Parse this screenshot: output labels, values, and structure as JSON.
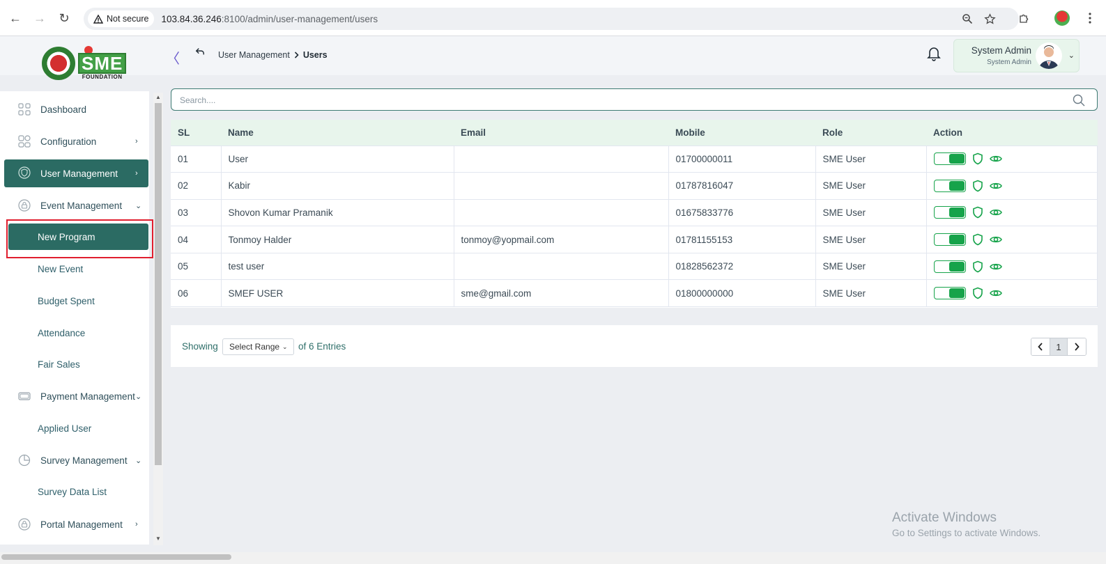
{
  "browser": {
    "security_label": "Not secure",
    "url_host": "103.84.36.246",
    "url_rest": ":8100/admin/user-management/users"
  },
  "header": {
    "logo_text": "SME",
    "logo_subtext": "FOUNDATION",
    "breadcrumb_parent": "User Management",
    "breadcrumb_current": "Users",
    "user_name": "System Admin",
    "user_role": "System Admin"
  },
  "sidebar": {
    "items": [
      {
        "label": "Dashboard"
      },
      {
        "label": "Configuration"
      },
      {
        "label": "User Management"
      },
      {
        "label": "Event Management"
      },
      {
        "label": "Payment Management"
      },
      {
        "label": "Survey Management"
      },
      {
        "label": "Portal Management"
      }
    ],
    "sub_items": [
      {
        "label": "New Program"
      },
      {
        "label": "New Event"
      },
      {
        "label": "Budget Spent"
      },
      {
        "label": "Attendance"
      },
      {
        "label": "Fair Sales"
      },
      {
        "label": "Applied User"
      },
      {
        "label": "Survey Data List"
      }
    ]
  },
  "search": {
    "placeholder": "Search...."
  },
  "table": {
    "headers": [
      "SL",
      "Name",
      "Email",
      "Mobile",
      "Role",
      "Action"
    ],
    "rows": [
      {
        "sl": "01",
        "name": "User",
        "email": "",
        "mobile": "01700000011",
        "role": "SME User"
      },
      {
        "sl": "02",
        "name": "Kabir",
        "email": "",
        "mobile": "01787816047",
        "role": "SME User"
      },
      {
        "sl": "03",
        "name": "Shovon Kumar Pramanik",
        "email": "",
        "mobile": "01675833776",
        "role": "SME User"
      },
      {
        "sl": "04",
        "name": "Tonmoy Halder",
        "email": "tonmoy@yopmail.com",
        "mobile": "01781155153",
        "role": "SME User"
      },
      {
        "sl": "05",
        "name": "test user",
        "email": "",
        "mobile": "01828562372",
        "role": "SME User"
      },
      {
        "sl": "06",
        "name": "SMEF USER",
        "email": "sme@gmail.com",
        "mobile": "01800000000",
        "role": "SME User"
      }
    ]
  },
  "pagination": {
    "showing_label": "Showing",
    "range_select": "Select Range",
    "entries_label": "of 6 Entries",
    "current_page": "1"
  },
  "watermark": {
    "line1": "Activate Windows",
    "line2": "Go to Settings to activate Windows."
  },
  "colors": {
    "accent": "#2b6b63",
    "toggle_on": "#16a34a",
    "highlight": "#e01e2e"
  }
}
